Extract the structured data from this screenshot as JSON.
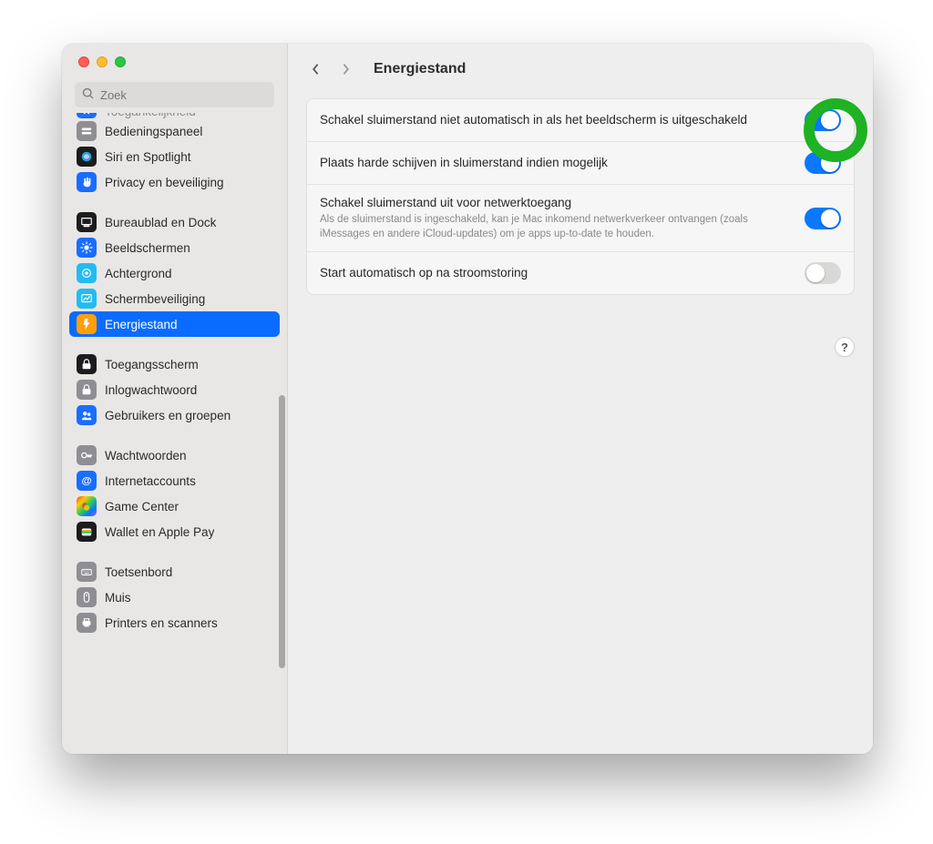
{
  "search": {
    "placeholder": "Zoek"
  },
  "header": {
    "title": "Energiestand"
  },
  "help": {
    "label": "?"
  },
  "sidebar": {
    "items": [
      {
        "label": "Toegankelijkheid",
        "icon": "accessibility-icon",
        "bg": "#1a6dff"
      },
      {
        "label": "Bedieningspaneel",
        "icon": "control-center-icon",
        "bg": "#8e8e93"
      },
      {
        "label": "Siri en Spotlight",
        "icon": "siri-icon",
        "bg": "#1c1c1e"
      },
      {
        "label": "Privacy en beveiliging",
        "icon": "hand-icon",
        "bg": "#1a6dff"
      },
      {
        "label": "Bureaublad en Dock",
        "icon": "dock-icon",
        "bg": "#1c1c1e"
      },
      {
        "label": "Beeldschermen",
        "icon": "displays-icon",
        "bg": "#1a6dff"
      },
      {
        "label": "Achtergrond",
        "icon": "wallpaper-icon",
        "bg": "#22bcf2"
      },
      {
        "label": "Schermbeveiliging",
        "icon": "screensaver-icon",
        "bg": "#22bcf2"
      },
      {
        "label": "Energiestand",
        "icon": "energy-icon",
        "bg": "#ff9f0a"
      },
      {
        "label": "Toegangsscherm",
        "icon": "lockscreen-icon",
        "bg": "#1c1c1e"
      },
      {
        "label": "Inlogwachtwoord",
        "icon": "lock-icon",
        "bg": "#8e8e93"
      },
      {
        "label": "Gebruikers en groepen",
        "icon": "users-icon",
        "bg": "#1a6dff"
      },
      {
        "label": "Wachtwoorden",
        "icon": "key-icon",
        "bg": "#8e8e93"
      },
      {
        "label": "Internetaccounts",
        "icon": "at-icon",
        "bg": "#1a6dff"
      },
      {
        "label": "Game Center",
        "icon": "gamecenter-icon",
        "bg": "linear"
      },
      {
        "label": "Wallet en Apple Pay",
        "icon": "wallet-icon",
        "bg": "#1c1c1e"
      },
      {
        "label": "Toetsenbord",
        "icon": "keyboard-icon",
        "bg": "#8e8e93"
      },
      {
        "label": "Muis",
        "icon": "mouse-icon",
        "bg": "#8e8e93"
      },
      {
        "label": "Printers en scanners",
        "icon": "printer-icon",
        "bg": "#8e8e93"
      }
    ],
    "groups": [
      [
        0,
        1,
        2,
        3
      ],
      [
        4,
        5,
        6,
        7,
        8
      ],
      [
        9,
        10,
        11
      ],
      [
        12,
        13,
        14,
        15
      ],
      [
        16,
        17,
        18
      ]
    ],
    "selectedIndex": 8,
    "truncatedTopIndex": 0
  },
  "settings": {
    "rows": [
      {
        "title": "Schakel sluimerstand niet automatisch in als het beeldscherm is uitgeschakeld",
        "desc": "",
        "on": true
      },
      {
        "title": "Plaats harde schijven in sluimerstand indien mogelijk",
        "desc": "",
        "on": true
      },
      {
        "title": "Schakel sluimerstand uit voor netwerktoegang",
        "desc": "Als de sluimerstand is ingeschakeld, kan je Mac inkomend netwerkverkeer ontvangen (zoals iMessages en andere iCloud-updates) om je apps up-to-date te houden.",
        "on": true
      },
      {
        "title": "Start automatisch op na stroomstoring",
        "desc": "",
        "on": false
      }
    ]
  },
  "annotation": {
    "highlightRow": 0
  }
}
